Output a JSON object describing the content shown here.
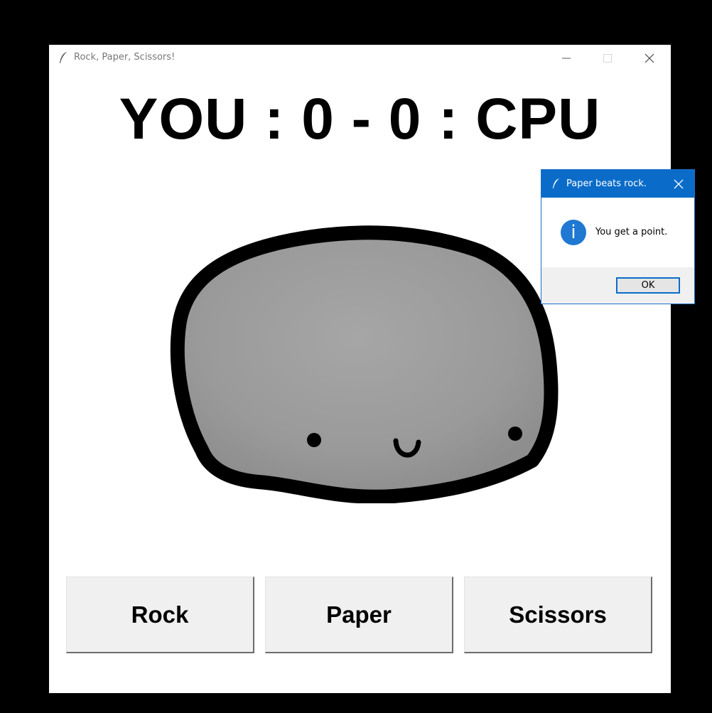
{
  "window": {
    "title": "Rock, Paper, Scissors!",
    "icons": {
      "app": "feather-icon",
      "minimize": "minimize-icon",
      "maximize": "maximize-icon",
      "close": "close-icon"
    }
  },
  "score": {
    "text": "YOU : 0 - 0 : CPU",
    "you": 0,
    "cpu": 0
  },
  "image": {
    "subject": "rock-character-icon"
  },
  "buttons": {
    "rock": "Rock",
    "paper": "Paper",
    "scissors": "Scissors"
  },
  "dialog": {
    "title": "Paper beats rock.",
    "message": "You get a point.",
    "ok_label": "OK",
    "icons": {
      "app": "feather-icon",
      "info": "info-icon",
      "close": "close-icon"
    },
    "colors": {
      "titlebar": "#0a6cc8",
      "info": "#1f78d1"
    }
  }
}
